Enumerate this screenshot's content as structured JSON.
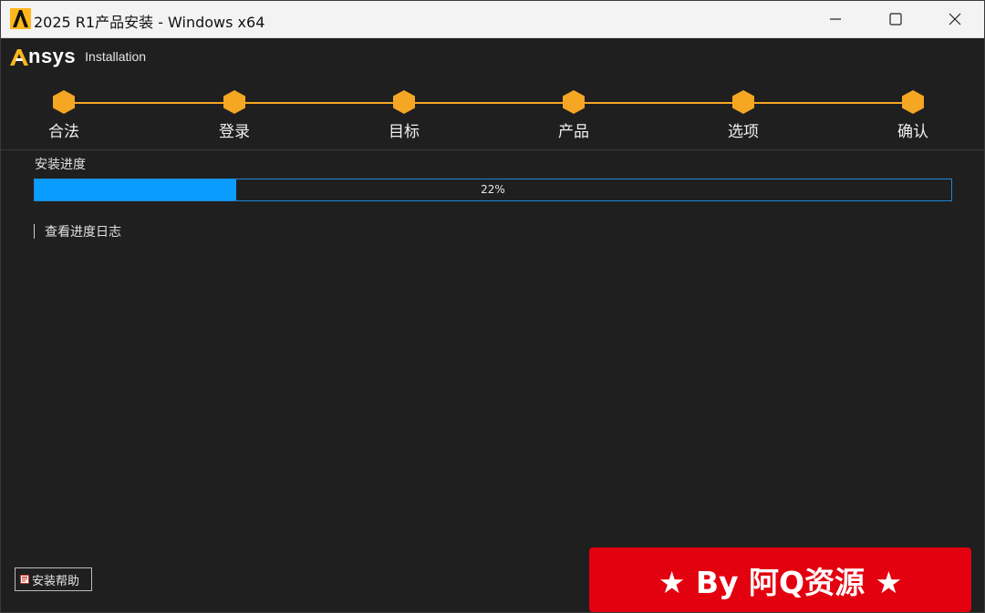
{
  "window": {
    "title": "2025 R1产品安装 - Windows x64"
  },
  "header": {
    "brand": "nsys",
    "subtitle": "Installation"
  },
  "steps": [
    {
      "label": "合法",
      "state": "done"
    },
    {
      "label": "登录",
      "state": "done"
    },
    {
      "label": "目标",
      "state": "done"
    },
    {
      "label": "产品",
      "state": "done"
    },
    {
      "label": "选项",
      "state": "done"
    },
    {
      "label": "确认",
      "state": "done"
    }
  ],
  "progress": {
    "label": "安装进度",
    "percent": 22,
    "text": "22%"
  },
  "log": {
    "label": "查看进度日志"
  },
  "footer": {
    "help_label": "安装帮助"
  },
  "watermark": {
    "text": "★ By 阿Q资源 ★"
  },
  "colors": {
    "accent_orange": "#f5a623",
    "progress_blue": "#0a9dff",
    "progress_border": "#1e88d8",
    "background": "#1f1f1f",
    "watermark_red": "#e3000f"
  },
  "icons": {
    "app": "ansys-a-icon",
    "minimize": "minimize-icon",
    "maximize": "maximize-icon",
    "close": "close-icon",
    "step": "hexagon-icon",
    "help": "help-doc-icon"
  }
}
